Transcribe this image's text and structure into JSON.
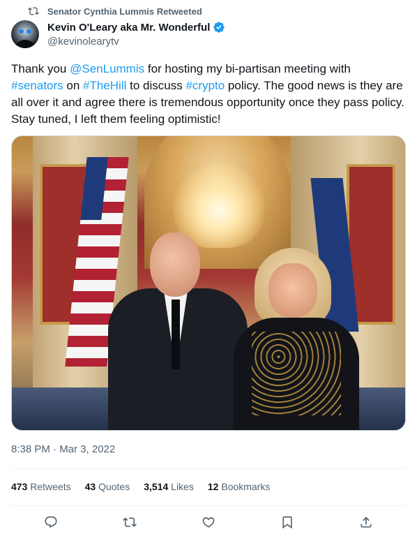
{
  "retweet_header": {
    "text": "Senator Cynthia Lummis Retweeted",
    "icon": "retweet-icon"
  },
  "author": {
    "display_name": "Kevin O'Leary aka Mr. Wonderful",
    "handle": "@kevinolearytv",
    "verified": true,
    "verified_icon": "verified-badge-icon",
    "avatar_icon": "avatar"
  },
  "tweet": {
    "segments": [
      {
        "text": "Thank you  ",
        "link": false
      },
      {
        "text": "@SenLummis",
        "link": true
      },
      {
        "text": " for hosting my bi-partisan meeting with ",
        "link": false
      },
      {
        "text": "#senators",
        "link": true
      },
      {
        "text": " on ",
        "link": false
      },
      {
        "text": "#TheHill",
        "link": true
      },
      {
        "text": " to discuss ",
        "link": false
      },
      {
        "text": "#crypto",
        "link": true
      },
      {
        "text": " policy. The good news is they are all over it and agree there is tremendous opportunity once they pass policy. Stay tuned, I left them feeling optimistic!",
        "link": false
      }
    ],
    "media": "photo",
    "timestamp": "8:38 PM · Mar 3, 2022"
  },
  "stats": [
    {
      "count": "473",
      "label": "Retweets"
    },
    {
      "count": "43",
      "label": "Quotes"
    },
    {
      "count": "3,514",
      "label": "Likes"
    },
    {
      "count": "12",
      "label": "Bookmarks"
    }
  ],
  "actions": [
    "reply-icon",
    "retweet-icon",
    "like-icon",
    "bookmark-icon",
    "share-icon"
  ],
  "colors": {
    "link": "#1d9bf0",
    "secondary": "#536471",
    "primary": "#0f1419",
    "verified": "#1d9bf0",
    "divider": "#eff3f4"
  }
}
